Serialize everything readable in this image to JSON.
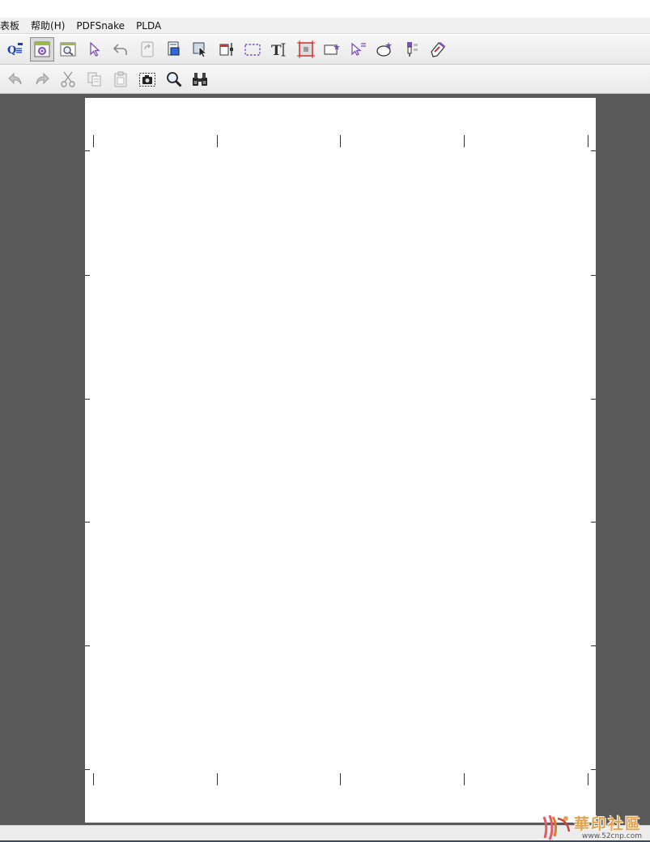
{
  "menubar": {
    "items": [
      "表板",
      "帮助(H)",
      "PDFSnake",
      "PLDA"
    ]
  },
  "toolbar1": {
    "icons": [
      "qt-designer-icon",
      "settings-panel-icon",
      "zoom-page-icon",
      "pointer-arrow-icon",
      "undo-arrow-icon",
      "page-rotate-icon",
      "page-preview-icon",
      "select-object-icon",
      "page-adjust-icon",
      "dashed-selection-icon",
      "text-tool-icon",
      "crop-marks-icon",
      "add-box-icon",
      "multi-select-icon",
      "sparkle-object-icon",
      "dropper-tool-icon",
      "script-edit-icon"
    ],
    "active_index": 1
  },
  "toolbar2": {
    "icons": [
      "undo-icon",
      "redo-icon",
      "cut-icon",
      "copy-icon",
      "paste-icon",
      "snapshot-icon",
      "magnifier-icon",
      "binoculars-icon"
    ]
  },
  "watermark": {
    "title": "華印社區",
    "url": "www.52cnp.com"
  },
  "colors": {
    "workspace": "#595959",
    "page": "#ffffff",
    "accent_purple": "#7a4fb5",
    "watermark_orange": "#e2a24f"
  }
}
